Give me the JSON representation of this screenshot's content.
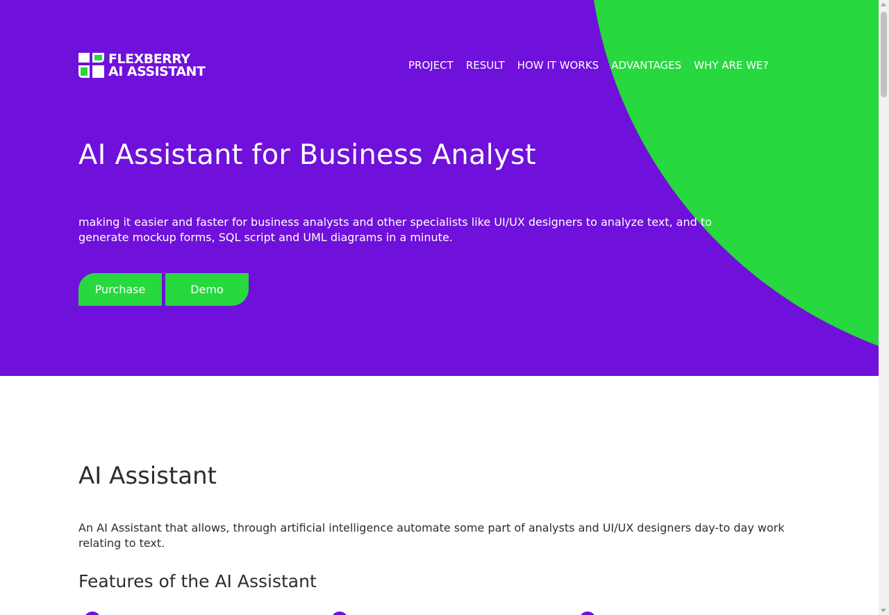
{
  "header": {
    "logo_line1": "FLEXBERRY",
    "logo_line2": "AI ASSISTANT",
    "nav": [
      {
        "label": "PROJECT"
      },
      {
        "label": "RESULT"
      },
      {
        "label": "HOW IT WORKS"
      },
      {
        "label": "ADVANTAGES"
      },
      {
        "label": "WHY ARE WE?"
      }
    ]
  },
  "hero": {
    "title": "AI Assistant for Business Analyst",
    "description": "making it easier and faster for business analysts and other specialists like UI/UX designers to analyze text, and to generate mockup forms, SQL script and UML diagrams in a minute.",
    "purchase_label": "Purchase",
    "demo_label": "Demo"
  },
  "about": {
    "title": "AI Assistant",
    "description": "An AI Assistant that allows, through artificial intelligence automate some part of analysts and UI/UX designers day-to day work relating to text.",
    "features_title": "Features of the AI Assistant"
  },
  "colors": {
    "purple": "#7010db",
    "green": "#27d83e",
    "text_dark": "#2d2d2d"
  }
}
